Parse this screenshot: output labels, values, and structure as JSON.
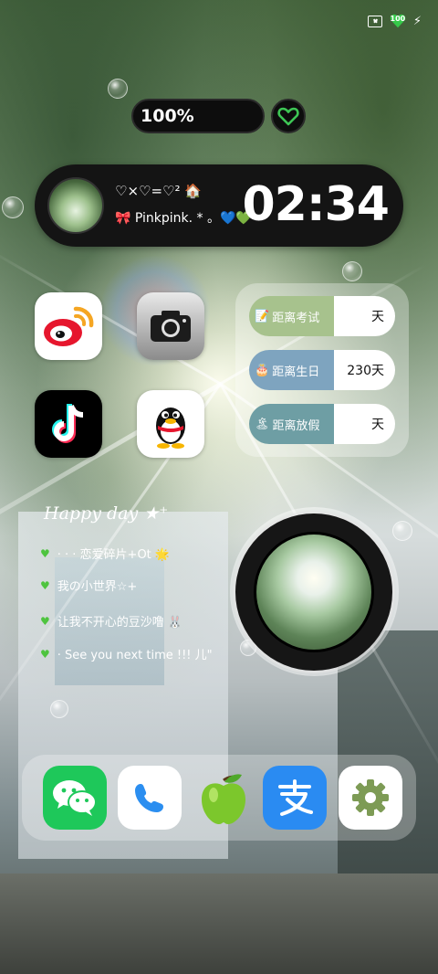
{
  "status_bar": {
    "battery_level": "100",
    "icons": [
      "sim-off-icon",
      "battery-heart-icon",
      "charging-bolt-icon"
    ]
  },
  "battery_widget": {
    "percent_text": "100%",
    "heart_icon": "heart-outline-icon",
    "accent": "#3ec655"
  },
  "clock_widget": {
    "line1": "♡×♡=♡² 🏠",
    "line2": "🎀 Pinkpink. * 。💙💚",
    "time": "02:34"
  },
  "apps": [
    {
      "name": "weibo",
      "icon": "weibo-icon"
    },
    {
      "name": "camera",
      "icon": "camera-icon"
    },
    {
      "name": "tiktok",
      "icon": "tiktok-icon"
    },
    {
      "name": "qq",
      "icon": "qq-penguin-icon"
    }
  ],
  "countdown": {
    "rows": [
      {
        "emoji": "📝",
        "label": "距离考试",
        "value": "天",
        "color": "#a7c28d"
      },
      {
        "emoji": "🎂",
        "label": "距离生日",
        "value": "230天",
        "color": "#7ea4bf"
      },
      {
        "emoji": "🏝",
        "label": "距离放假",
        "value": "天",
        "color": "#6e9ea4"
      }
    ]
  },
  "happy": {
    "title": "Happy day ★⁺",
    "items": [
      "· · · 恋爱碎片+Ot 🌟",
      "我の小世界☆+",
      "让我不开心的豆沙噜 🐰",
      "· See you next time !!! 儿\""
    ]
  },
  "dock": {
    "apps": [
      {
        "name": "wechat",
        "icon": "wechat-icon"
      },
      {
        "name": "phone",
        "icon": "phone-icon"
      },
      {
        "name": "apple",
        "icon": "green-apple-icon"
      },
      {
        "name": "alipay",
        "icon": "alipay-icon"
      },
      {
        "name": "settings",
        "icon": "gear-icon"
      }
    ]
  }
}
